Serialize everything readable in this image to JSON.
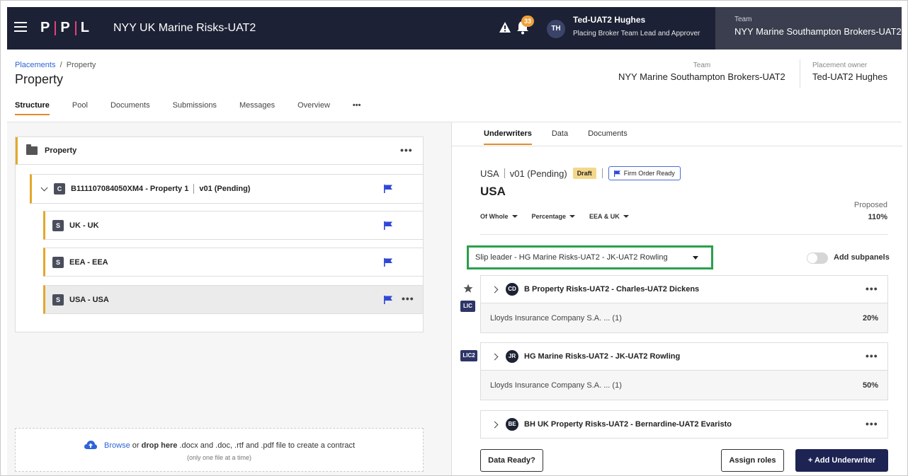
{
  "topbar": {
    "logo": [
      "P",
      "P",
      "L"
    ],
    "app_title": "NYY UK Marine Risks-UAT2",
    "notifications_count": "33",
    "user_initials": "TH",
    "user_name": "Ted-UAT2 Hughes",
    "user_role": "Placing Broker Team Lead and Approver",
    "team_label": "Team",
    "team_value": "NYY Marine Southampton Brokers-UAT2"
  },
  "header": {
    "breadcrumb_link": "Placements",
    "breadcrumb_sep": "/",
    "breadcrumb_current": "Property",
    "title": "Property",
    "team_label": "Team",
    "team_value": "NYY Marine Southampton Brokers-UAT2",
    "owner_label": "Placement owner",
    "owner_value": "Ted-UAT2 Hughes",
    "tabs": [
      "Structure",
      "Pool",
      "Documents",
      "Submissions",
      "Messages",
      "Overview"
    ],
    "more_label": "•••"
  },
  "tree": {
    "root_label": "Property",
    "contract": {
      "badge": "C",
      "label": "B111107084050XM4 - Property 1",
      "version": "v01 (Pending)"
    },
    "sections": [
      {
        "badge": "S",
        "label": "UK - UK"
      },
      {
        "badge": "S",
        "label": "EEA - EEA"
      },
      {
        "badge": "S",
        "label": "USA - USA"
      }
    ],
    "more_label": "•••"
  },
  "upload": {
    "browse": "Browse",
    "or": " or ",
    "drop": "drop here",
    "rest": " .docx and .doc, .rtf and .pdf file to create a contract",
    "note": "(only one file at a time)"
  },
  "right": {
    "tabs": [
      "Underwriters",
      "Data",
      "Documents"
    ],
    "version_prefix": "USA",
    "version": "v01 (Pending)",
    "draft": "Draft",
    "firm_order": "Firm Order Ready",
    "section_title": "USA",
    "proposed_label": "Proposed",
    "proposed_value": "110%",
    "filters": [
      "Of Whole",
      "Percentage",
      "EEA & UK"
    ],
    "slip_leader": "Slip leader - HG Marine Risks-UAT2 - JK-UAT2 Rowling",
    "add_subpanels": "Add subpanels",
    "underwriters": [
      {
        "initials": "CD",
        "name": "B Property Risks-UAT2 - Charles-UAT2 Dickens",
        "company": "Lloyds Insurance Company S.A. ... (1)",
        "pct": "20%",
        "role": "LIC"
      },
      {
        "initials": "JR",
        "name": "HG Marine Risks-UAT2 - JK-UAT2 Rowling",
        "company": "Lloyds Insurance Company S.A. ... (1)",
        "pct": "50%",
        "role": "LIC2"
      },
      {
        "initials": "BE",
        "name": "BH UK Property Risks-UAT2 - Bernardine-UAT2 Evaristo"
      }
    ],
    "more_label": "•••",
    "data_ready": "Data Ready?",
    "assign_roles": "Assign roles",
    "add_underwriter": "+  Add Underwriter"
  },
  "colors": {
    "topbar_bg": "#1c2135",
    "accent_orange": "#e38b2c",
    "link_blue": "#2e64d7",
    "highlight_green": "#2aa04b",
    "primary_button": "#1d2454"
  }
}
